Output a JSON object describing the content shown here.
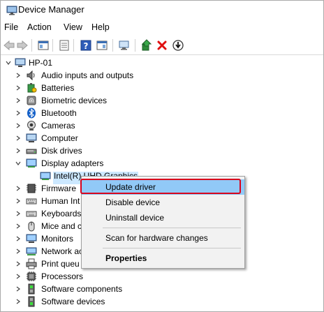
{
  "window": {
    "title": "Device Manager"
  },
  "menu": [
    "File",
    "Action",
    "View",
    "Help"
  ],
  "tree": {
    "root": "HP-01",
    "categories": [
      "Audio inputs and outputs",
      "Batteries",
      "Biometric devices",
      "Bluetooth",
      "Cameras",
      "Computer",
      "Disk drives",
      "Display adapters",
      "Intel(R) UHD Graphics",
      "Firmware",
      "Human Int",
      "Keyboards",
      "Mice and c",
      "Monitors",
      "Network ac",
      "Print queu",
      "Processors",
      "Software components",
      "Software devices"
    ]
  },
  "context_menu": {
    "items": [
      "Update driver",
      "Disable device",
      "Uninstall device",
      "Scan for hardware changes",
      "Properties"
    ]
  },
  "colors": {
    "selection": "#cce8ff",
    "highlight": "#91c9f7",
    "callout": "#d9001b",
    "delete": "#e01010"
  }
}
